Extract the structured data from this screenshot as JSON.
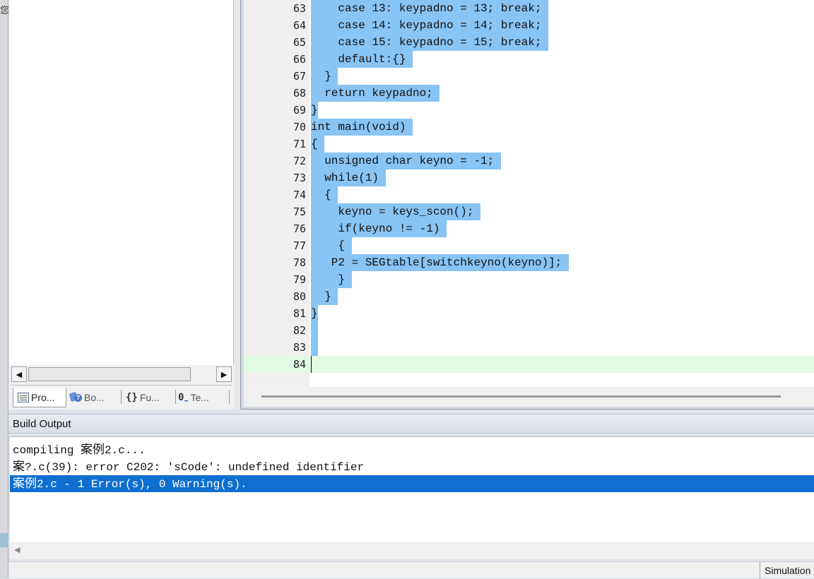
{
  "left_sliver": {
    "char": "您"
  },
  "project_panel": {
    "tabs": [
      {
        "label": "Pro...",
        "icon": "project-icon",
        "active": true
      },
      {
        "label": "Bo...",
        "icon": "books-icon",
        "active": false
      },
      {
        "label": "Fu...",
        "icon": "functions-icon",
        "icon_glyph": "{}",
        "active": false
      },
      {
        "label": "Te...",
        "icon": "templates-icon",
        "icon_glyph": "0",
        "active": false
      }
    ],
    "scroll_left": "◀",
    "scroll_right": "▶"
  },
  "editor": {
    "lines": [
      {
        "num": "63",
        "text": "    case 13: keypadno = 13; break; "
      },
      {
        "num": "64",
        "text": "    case 14: keypadno = 14; break; "
      },
      {
        "num": "65",
        "text": "    case 15: keypadno = 15; break; "
      },
      {
        "num": "66",
        "text": "    default:{} "
      },
      {
        "num": "67",
        "text": "  } "
      },
      {
        "num": "68",
        "text": "  return keypadno; "
      },
      {
        "num": "69",
        "text": "}"
      },
      {
        "num": "70",
        "text": "int main(void) "
      },
      {
        "num": "71",
        "text": "{ "
      },
      {
        "num": "72",
        "text": "  unsigned char keyno = -1; "
      },
      {
        "num": "73",
        "text": "  while(1) "
      },
      {
        "num": "74",
        "text": "  { "
      },
      {
        "num": "75",
        "text": "    keyno = keys_scon(); "
      },
      {
        "num": "76",
        "text": "    if(keyno != -1) "
      },
      {
        "num": "77",
        "text": "    { "
      },
      {
        "num": "78",
        "text": "   P2 = SEGtable[switchkeyno(keyno)]; "
      },
      {
        "num": "79",
        "text": "    } "
      },
      {
        "num": "80",
        "text": "  } "
      },
      {
        "num": "81",
        "text": "}"
      },
      {
        "num": "82",
        "text": " "
      },
      {
        "num": "83",
        "text": " "
      },
      {
        "num": "84",
        "text": ""
      }
    ]
  },
  "build_output": {
    "title": "Build Output",
    "lines": [
      {
        "cjk": "",
        "pre": "compiling ",
        "cjk_mid": "案例",
        "post": "2.c..."
      },
      {
        "cjk": "案",
        "pre": "",
        "cjk_mid": "",
        "post": "?.c(39): error C202: 'sCode': undefined identifier"
      },
      {
        "cjk": "案例",
        "pre": "",
        "cjk_mid": "",
        "post": "2.c - 1 Error(s), 0 Warning(s)."
      }
    ]
  },
  "status_bar": {
    "mode": "Simulation"
  }
}
